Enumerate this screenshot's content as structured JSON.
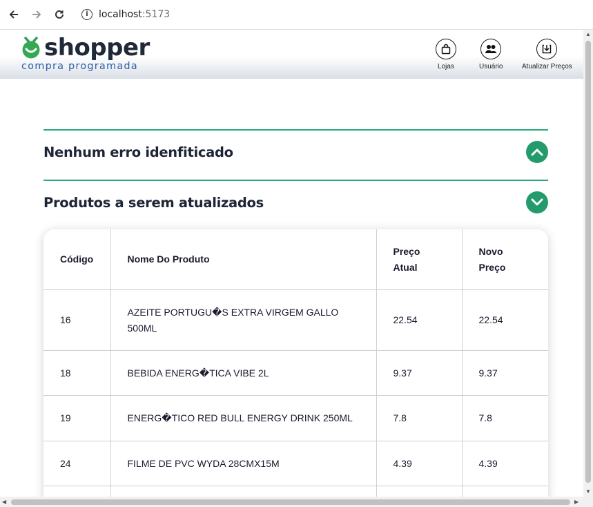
{
  "browser": {
    "url_host": "localhost",
    "url_port": ":5173"
  },
  "header": {
    "logo_text": "shopper",
    "logo_sub": "compra programada",
    "buttons": [
      {
        "label": "Lojas",
        "icon": "shopping-bag-icon"
      },
      {
        "label": "Usuário",
        "icon": "users-icon"
      },
      {
        "label": "Atualizar Preços",
        "icon": "download-icon"
      }
    ]
  },
  "sections": {
    "errors_title": "Nenhum erro idenfiticado",
    "products_title": "Produtos a serem atualizados"
  },
  "table": {
    "headers": {
      "code": "Código",
      "name": "Nome Do Produto",
      "price_1": "Preço",
      "price_2": "Atual",
      "new_1": "Novo",
      "new_2": "Preço"
    },
    "rows": [
      {
        "code": "16",
        "name": "AZEITE PORTUGU�S EXTRA VIRGEM GALLO 500ML",
        "price": "22.54",
        "new_price": "22.54"
      },
      {
        "code": "18",
        "name": "BEBIDA ENERG�TICA VIBE 2L",
        "price": "9.37",
        "new_price": "9.37"
      },
      {
        "code": "19",
        "name": "ENERG�TICO RED BULL ENERGY DRINK 250ML",
        "price": "7.8",
        "new_price": "7.8"
      },
      {
        "code": "24",
        "name": "FILME DE PVC WYDA 28CMX15M",
        "price": "4.39",
        "new_price": "4.39"
      }
    ]
  },
  "colors": {
    "accent": "#239b6b",
    "divider": "#2aa97c",
    "logo_blue": "#2c5fa8"
  }
}
